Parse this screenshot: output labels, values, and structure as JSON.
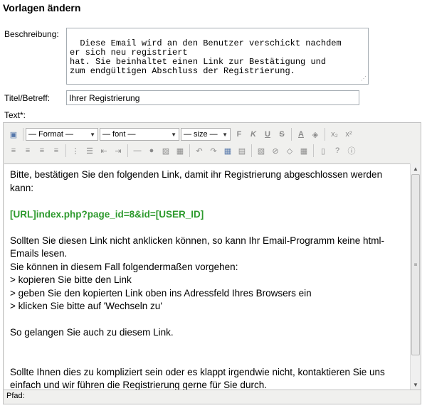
{
  "page": {
    "heading": "Vorlagen ändern"
  },
  "form": {
    "description_label": "Beschreibung:",
    "description_value": "Diese Email wird an den Benutzer verschickt nachdem\ner sich neu registriert\nhat. Sie beinhaltet einen Link zur Bestätigung und\nzum endgültigen Abschluss der Registrierung.",
    "title_label": "Titel/Betreff:",
    "title_value": "Ihrer Registrierung",
    "text_label": "Text*:"
  },
  "toolbar": {
    "format_select": "— Format —",
    "font_select": "— font —",
    "size_select": "— size —",
    "bold": "F",
    "italic": "K",
    "underline": "U",
    "strike": "S",
    "font_color": "A",
    "subscript": "x₂",
    "superscript": "x²"
  },
  "editor": {
    "lines": [
      "Bitte, bestätigen Sie den folgenden Link, damit ihr Registrierung abgeschlossen werden kann:",
      "",
      "[URL]index.php?page_id=8&id=[USER_ID]",
      "",
      "Sollten Sie diesen Link nicht anklicken können, so kann Ihr Email-Programm keine html-Emails lesen.",
      "Sie können in diesem Fall folgendermaßen vorgehen:",
      "> kopieren Sie bitte den Link",
      "> geben Sie den kopierten Link oben ins Adressfeld Ihres Browsers ein",
      "> klicken Sie bitte auf 'Wechseln zu'",
      "",
      "So gelangen Sie auch zu diesem Link.",
      "",
      "",
      "Sollte Ihnen dies zu kompliziert sein oder es klappt irgendwie nicht, kontaktieren Sie uns einfach und wir führen die Registrierung gerne für Sie durch."
    ],
    "status_path": "Pfad:"
  },
  "colors": {
    "link_green": "#2e9a2e",
    "toolbar_bg": "#f0f0ee"
  }
}
